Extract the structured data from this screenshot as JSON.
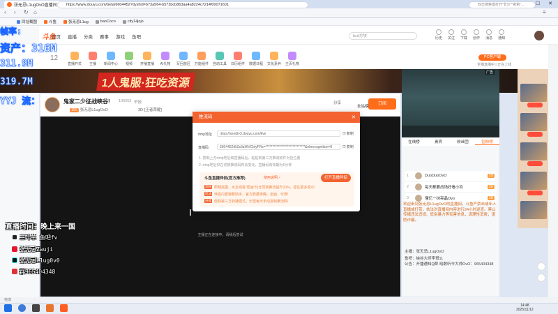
{
  "browser": {
    "tab_title": "张无忌L1ugOvO直播间",
    "new_tab": "+",
    "url": "https://www.douyu.com/beta/6604452?dyshid=b73a564-b572bcb863aa4a8224c7214f00071601",
    "search_hint": "双击搜索或打开\"长沙\"\"莉莉\"...",
    "bookmarks": [
      "同址载图",
      "斗鱼",
      "张无忌L1ug",
      "baoCoco",
      "city14jojo"
    ]
  },
  "site": {
    "logo": "斗鱼",
    "nav": [
      "首页",
      "直播",
      "分类",
      "赛事",
      "游戏",
      "鱼吧"
    ],
    "search_placeholder": "bcd方块",
    "user_icons": [
      "历史",
      "关注",
      "下载",
      "创作",
      "消息",
      "通知"
    ],
    "category_count": "12",
    "categories": [
      "直播开关",
      "主播",
      "新闻中心",
      "视频",
      "开播直播",
      "AI礼物",
      "写回放区",
      "万能组件",
      "自动工具",
      "日历组件",
      "数据日程",
      "文化素养",
      "主页礼物"
    ],
    "pc_button": "PC客户端",
    "pc_sub": "全播直播中 | 正在上线"
  },
  "banner": {
    "text": "1人鬼服·狂吃资源",
    "ad_tag": "广告"
  },
  "room": {
    "title": "鬼家二少征战峡谷!",
    "room_id": "106053",
    "report": "举报",
    "host_name": "张无忌L1ugOvO",
    "level": "155",
    "category": "3D-[王者荣耀]",
    "share": "分享",
    "subscribe": "订阅",
    "rank": "全站榜"
  },
  "video": {
    "status": "主播正在连接中，请稍后尝试"
  },
  "chat": {
    "tabs": [
      "在线榜",
      "贵宾",
      "粉丝团",
      "钻粉榜"
    ],
    "fans": [
      {
        "rank": "1",
        "name": "DuoDuoOvO",
        "level": "29"
      },
      {
        "rank": "2",
        "name": "每天都要战场好看小欢",
        "level": "26"
      },
      {
        "rank": "3",
        "name": "懂忆一抹亮晶Ovo",
        "level": "28"
      }
    ],
    "notice": "欢迎来到张无忌L1ugOvO的直播间。斗鱼严禁未成年人直播或打赏，依法对直播间内容进行24小时巡查。禁止传播违法违规、低俗暴力等有害信息，请理性消费，谨防诈骗。",
    "info": [
      "主播：张无忌L1ugOvO",
      "鱼吧：峡谷大师李哥11",
      "公告：开播通知Q群·晓数听令大师OvO：965404348"
    ]
  },
  "modal": {
    "title": "推流码",
    "rtmp_label": "rtmp地址",
    "rtmp_value": "rtmp://sendtv3.douyu.com/live",
    "code_label": "直播码",
    "code_value": "6604452rBZs3aWVCldyFRs=*****************************&ehrecognition=0",
    "copy": "复制",
    "tip1": "1. 复制上方rtmp地址和直播码后，粘贴到第三方推流软件对应位置",
    "tip2": "2. rtmp地址仅在切换推流码时会变化，直播码有效期为5分钟",
    "assistant_title": "斗鱼直播伴侣(官方推荐)",
    "assistant_link": "使用说明 ›",
    "open_button": "打开直播伴侣",
    "features": [
      {
        "badge": "流畅",
        "text": "照明黑图、水友观看\"原画\"均比同类推流提升20%，留住更多观众!"
      },
      {
        "badge": "玩法",
        "text": "伴侣内置弹幕助手、官方数据准确、全面、可靠!"
      },
      {
        "badge": "分成",
        "text": "借助第三方转播模式，无需每天手动复制推流码!"
      }
    ]
  },
  "obs_overlay": {
    "label": "帧率:",
    "cpu": "资产：316M",
    "mem1": "311.9M",
    "mem2": "319.7M",
    "extra": "YYJ 流：",
    "live_time": "直播时间：晚上来一国",
    "socials": [
      {
        "icon": "qq-icon",
        "text": "三叶草  鱼吧fv"
      },
      {
        "icon": "weibo-icon",
        "text": "张无忌Zwuji"
      },
      {
        "icon": "douyin-icon",
        "text": "张无忌L1ug0v0"
      },
      {
        "icon": "group-icon",
        "text": "群965404348"
      }
    ]
  },
  "status_bar": "完成",
  "taskbar": {
    "time": "14:48",
    "date": "2025/11/12"
  },
  "colors": {
    "accent": "#ff6c1a",
    "modal_header": "#f3632f",
    "overlay_stroke": "#1a66ff"
  }
}
